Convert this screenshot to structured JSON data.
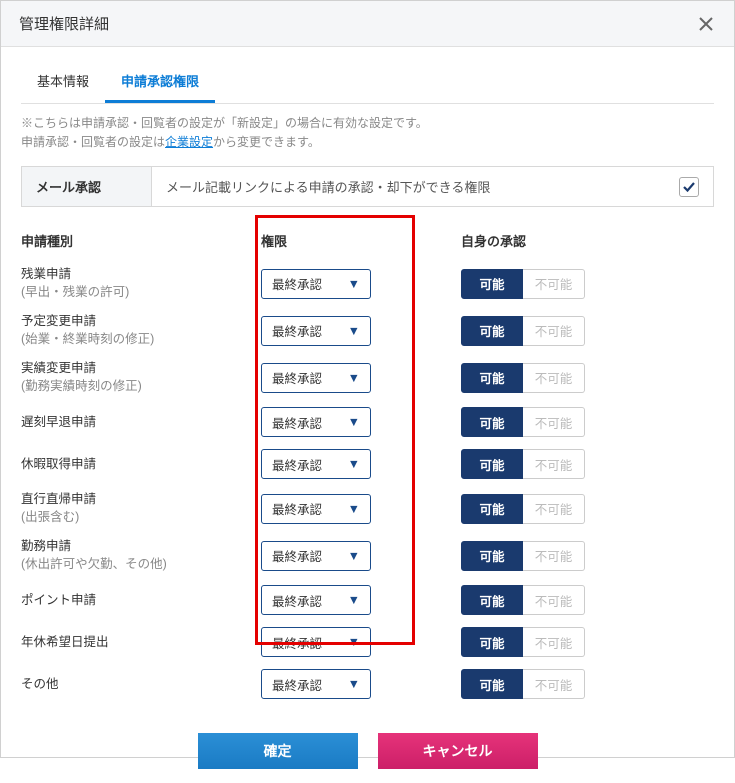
{
  "dialog": {
    "title": "管理権限詳細"
  },
  "tabs": {
    "basic": "基本情報",
    "approval": "申請承認権限"
  },
  "notice": {
    "prefix": "※こちらは申請承認・回覧者の設定が「新設定」の場合に有効な設定です。",
    "line2a": "申請承認・回覧者の設定は",
    "link": "企業設定",
    "line2b": "から変更できます。"
  },
  "mail": {
    "label": "メール承認",
    "desc": "メール記載リンクによる申請の承認・却下ができる権限"
  },
  "headers": {
    "type": "申請種別",
    "perm": "権限",
    "self": "自身の承認"
  },
  "permValue": "最終承認",
  "toggle": {
    "on": "可能",
    "off": "不可能"
  },
  "rows": [
    {
      "name": "残業申請",
      "sub": "(早出・残業の許可)"
    },
    {
      "name": "予定変更申請",
      "sub": "(始業・終業時刻の修正)"
    },
    {
      "name": "実績変更申請",
      "sub": "(勤務実績時刻の修正)"
    },
    {
      "name": "遅刻早退申請",
      "sub": ""
    },
    {
      "name": "休暇取得申請",
      "sub": ""
    },
    {
      "name": "直行直帰申請",
      "sub": "(出張含む)"
    },
    {
      "name": "勤務申請",
      "sub": "(休出許可や欠勤、その他)"
    },
    {
      "name": "ポイント申請",
      "sub": ""
    },
    {
      "name": "年休希望日提出",
      "sub": ""
    },
    {
      "name": "その他",
      "sub": ""
    }
  ],
  "buttons": {
    "confirm": "確定",
    "cancel": "キャンセル"
  }
}
